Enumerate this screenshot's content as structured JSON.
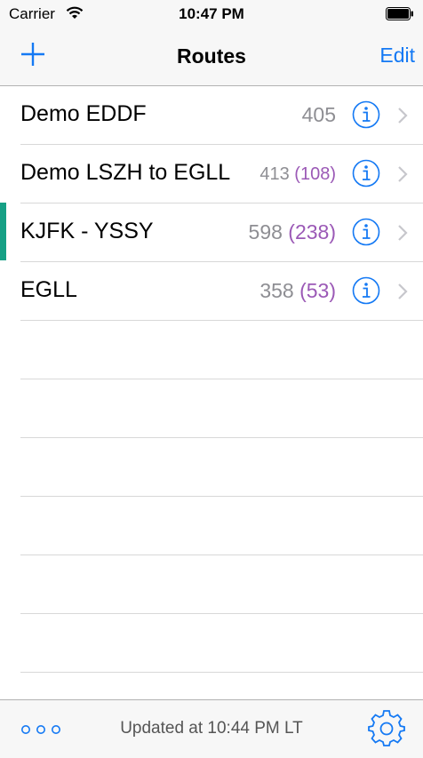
{
  "status_bar": {
    "carrier": "Carrier",
    "time": "10:47 PM"
  },
  "nav": {
    "title": "Routes",
    "edit_label": "Edit",
    "add_icon": "plus-icon"
  },
  "routes": [
    {
      "name": "Demo EDDF",
      "count": "405",
      "sub": ""
    },
    {
      "name": "Demo LSZH to EGLL",
      "count": "413",
      "sub": "(108)"
    },
    {
      "name": "KJFK - YSSY",
      "count": "598",
      "sub": "(238)"
    },
    {
      "name": "EGLL",
      "count": "358",
      "sub": "(53)"
    }
  ],
  "selected_route_index": 2,
  "toolbar": {
    "updated_text": "Updated at 10:44 PM LT",
    "more_icon": "more-icon",
    "settings_icon": "gear-icon"
  },
  "colors": {
    "accent": "#1479f4",
    "subcount": "#9b59b6",
    "count": "#8e8e93",
    "selection_marker": "#16a085"
  }
}
